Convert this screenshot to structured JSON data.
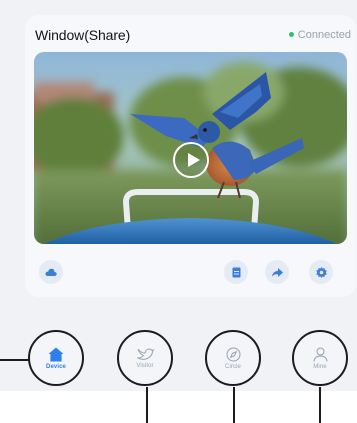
{
  "card": {
    "title": "Window(Share)",
    "status": "Connected",
    "status_color": "#2fbf71",
    "video": {
      "state": "paused",
      "icon": "play-icon"
    },
    "controls": [
      {
        "icon": "cloud-icon"
      },
      {
        "icon": "document-icon"
      },
      {
        "icon": "share-arrow-icon"
      },
      {
        "icon": "gear-icon"
      }
    ]
  },
  "tabbar": {
    "active_color": "#2f80ed",
    "inactive_color": "#9aa3ae",
    "tabs": [
      {
        "label": "Device",
        "icon": "home-icon",
        "active": true
      },
      {
        "label": "Visitor",
        "icon": "bird-icon",
        "active": false
      },
      {
        "label": "Circle",
        "icon": "compass-icon",
        "active": false
      },
      {
        "label": "Mine",
        "icon": "user-icon",
        "active": false
      }
    ]
  }
}
